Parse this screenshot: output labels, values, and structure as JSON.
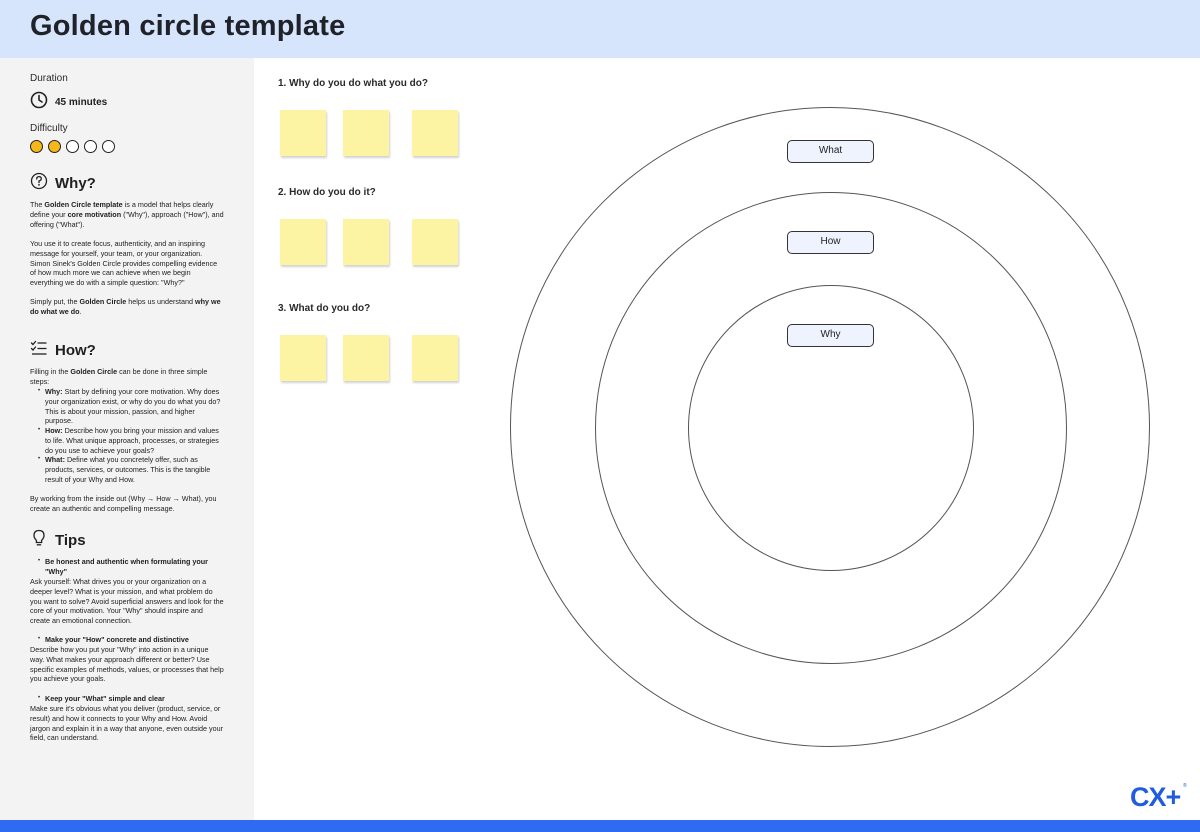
{
  "header": {
    "title": "Golden circle template"
  },
  "sidebar": {
    "duration_label": "Duration",
    "duration_value": "45 minutes",
    "difficulty_label": "Difficulty",
    "difficulty_level": 2,
    "difficulty_max": 5,
    "why": {
      "title": "Why?",
      "p1": {
        "a": "The ",
        "b": "Golden Circle template",
        "c": " is a model that helps clearly define your ",
        "d": "core motivation",
        "e": " (\"Why\"), approach (\"How\"), and offering (\"What\")."
      },
      "p2": "You use it to create focus, authenticity, and an inspiring message for yourself, your team, or your organization. Simon Sinek's Golden Circle provides compelling evidence of how much more we can achieve when we begin everything we do with a simple question: \"Why?\"",
      "p3": {
        "a": "Simply put, the ",
        "b": "Golden Circle",
        "c": " helps us understand ",
        "d": "why we do what we do",
        "e": "."
      }
    },
    "how": {
      "title": "How?",
      "intro": {
        "a": "Filling in the ",
        "b": "Golden Circle",
        "c": " can be done in three simple steps:"
      },
      "steps": [
        {
          "term": "Why:",
          "text": " Start by defining your core motivation. Why does your organization exist, or why do you do what you do? This is about your mission, passion, and higher purpose."
        },
        {
          "term": "How:",
          "text": " Describe how you bring your mission and values to life. What unique approach, processes, or strategies do you use to achieve your goals?"
        },
        {
          "term": "What:",
          "text": " Define what you concretely offer, such as products, services, or outcomes. This is the tangible result of your Why and How."
        }
      ],
      "outro": "By working from the inside out (Why → How → What), you create an authentic and compelling message."
    },
    "tips": {
      "title": "Tips",
      "items": [
        {
          "heading": "Be honest and authentic when formulating your \"Why\"",
          "body": "Ask yourself: What drives you or your organization on a deeper level? What is your mission, and what problem do you want to solve? Avoid superficial answers and look for the core of your motivation. Your \"Why\" should inspire and create an emotional connection."
        },
        {
          "heading": "Make your \"How\" concrete and distinctive",
          "body": "Describe how you put your \"Why\" into action in a unique way. What makes your approach different or better? Use specific examples of methods, values, or processes that help you achieve your goals."
        },
        {
          "heading": "Keep your \"What\" simple and clear",
          "body": "Make sure it's obvious what you deliver (product, service, or result) and how it connects to your Why and How. Avoid jargon and explain it in a way that anyone, even outside your field, can understand."
        }
      ]
    }
  },
  "questions": [
    {
      "label": "1. Why do you do what you do?"
    },
    {
      "label": "2. How do you do it?"
    },
    {
      "label": "3. What do you do?"
    }
  ],
  "circle_labels": {
    "outer": "What",
    "middle": "How",
    "inner": "Why"
  },
  "logo": {
    "text": "CX+",
    "mark": "®"
  },
  "colors": {
    "header_bg": "#d6e4fc",
    "sticky_note": "#fdf4a3",
    "difficulty_filled": "#f5b719",
    "brand": "#2f6bf2"
  },
  "icons": {
    "duration": "clock-icon",
    "why": "question-circle-icon",
    "how": "checklist-icon",
    "tips": "lightbulb-icon"
  }
}
